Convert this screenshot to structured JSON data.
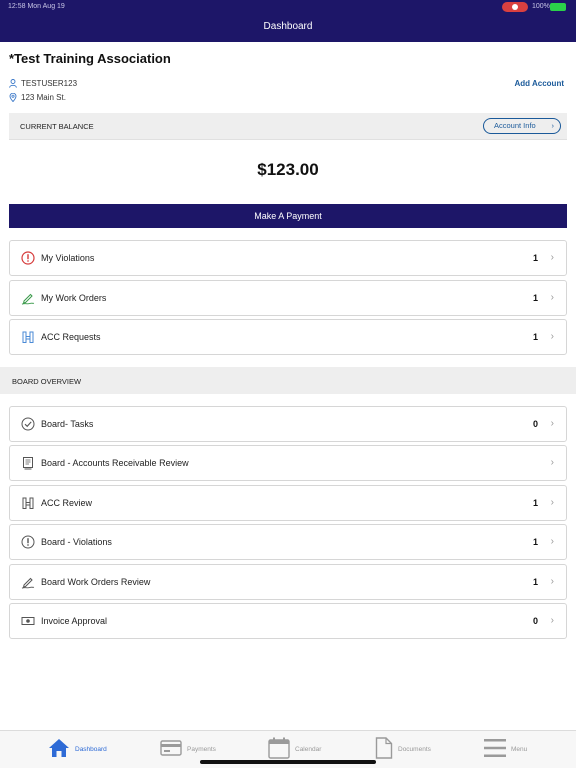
{
  "status_bar": {
    "time": "12:58  Mon Aug 19",
    "battery": "100%"
  },
  "nav": {
    "title": "Dashboard"
  },
  "header": {
    "association": "*Test Training Association",
    "user": "TESTUSER123",
    "address": "123 Main St.",
    "add_account": "Add Account"
  },
  "balance": {
    "label": "CURRENT BALANCE",
    "account_info": "Account Info",
    "amount": "$123.00",
    "pay_button": "Make A Payment"
  },
  "my_items": [
    {
      "label": "My Violations",
      "count": "1",
      "icon": "alert-circle-icon"
    },
    {
      "label": "My Work Orders",
      "count": "1",
      "icon": "pen-sign-icon"
    },
    {
      "label": "ACC Requests",
      "count": "1",
      "icon": "building-icon"
    }
  ],
  "board": {
    "header": "BOARD OVERVIEW",
    "items": [
      {
        "label": "Board- Tasks",
        "count": "0",
        "icon": "check-circle-icon"
      },
      {
        "label": "Board - Accounts Receivable Review",
        "count": "",
        "icon": "ledger-icon"
      },
      {
        "label": "ACC Review",
        "count": "1",
        "icon": "building-icon"
      },
      {
        "label": "Board - Violations",
        "count": "1",
        "icon": "alert-circle-icon"
      },
      {
        "label": "Board Work Orders Review",
        "count": "1",
        "icon": "pen-sign-icon"
      },
      {
        "label": "Invoice Approval",
        "count": "0",
        "icon": "cash-icon"
      }
    ]
  },
  "tabs": [
    {
      "label": "Dashboard",
      "icon": "home-icon",
      "active": true
    },
    {
      "label": "Payments",
      "icon": "credit-card-icon",
      "active": false
    },
    {
      "label": "Calendar",
      "icon": "calendar-icon",
      "active": false
    },
    {
      "label": "Documents",
      "icon": "document-icon",
      "active": false
    },
    {
      "label": "Menu",
      "icon": "menu-icon",
      "active": false
    }
  ],
  "colors": {
    "brand": "#1d1668",
    "link": "#1b5a9a",
    "alert": "#d63b3b",
    "work": "#3a9a4a",
    "acc": "#4a8ad6",
    "tab_active": "#2e6bd6"
  }
}
